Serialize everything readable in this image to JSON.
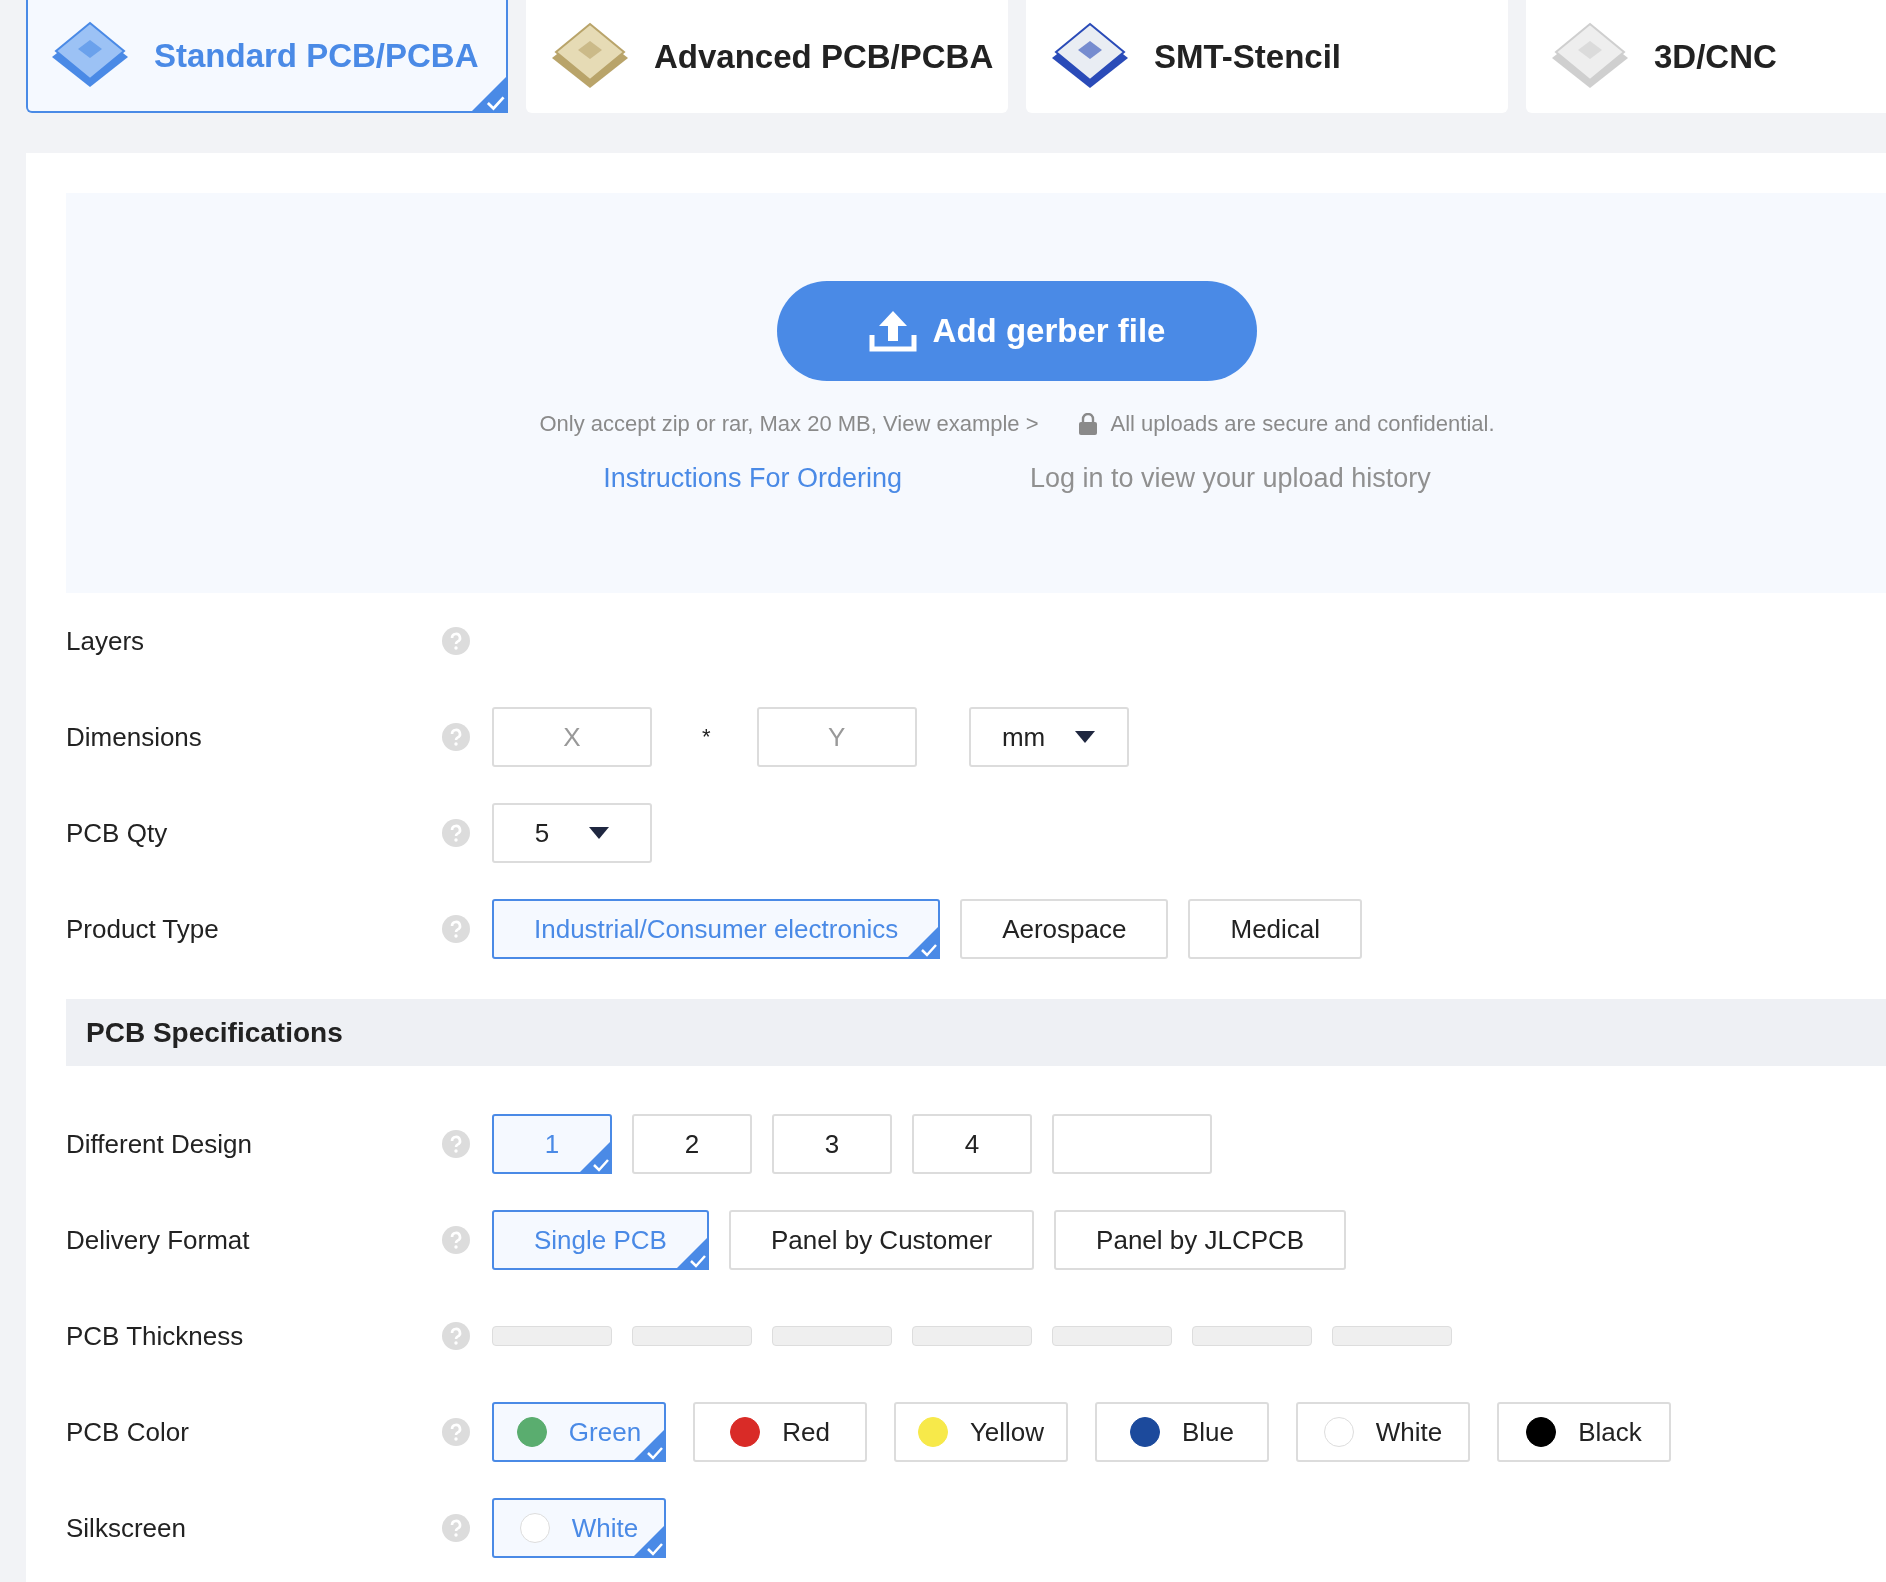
{
  "tabs": [
    {
      "label": "Standard PCB/PCBA",
      "selected": true,
      "kind": "standard"
    },
    {
      "label": "Advanced PCB/PCBA",
      "selected": false,
      "kind": "advanced"
    },
    {
      "label": "SMT-Stencil",
      "selected": false,
      "kind": "stencil"
    },
    {
      "label": "3D/CNC",
      "selected": false,
      "kind": "cnc"
    }
  ],
  "upload": {
    "button": "Add gerber file",
    "hint": "Only accept zip or rar, Max 20 MB, View example >",
    "secure_note": "All uploads are secure and confidential.",
    "instructions_link": "Instructions For Ordering",
    "history_link": "Log in to view your upload history"
  },
  "form_rows": [
    {
      "kind": "empty",
      "label": "Layers"
    },
    {
      "kind": "dimensions",
      "label": "Dimensions",
      "x_placeholder": "X",
      "separator": "*",
      "y_placeholder": "Y",
      "unit": "mm"
    },
    {
      "kind": "select",
      "label": "PCB Qty",
      "value": "5"
    },
    {
      "kind": "options",
      "label": "Product Type",
      "options": [
        {
          "kind": "option",
          "label": "Industrial/Consumer electronics",
          "selected": true
        },
        {
          "kind": "option",
          "label": "Aerospace",
          "selected": false
        },
        {
          "kind": "option",
          "label": "Medical",
          "selected": false
        }
      ]
    }
  ],
  "section_title": "PCB Specifications",
  "spec_rows": [
    {
      "kind": "options",
      "label": "Different Design",
      "options": [
        {
          "kind": "option",
          "label": "1",
          "selected": true
        },
        {
          "kind": "option",
          "label": "2",
          "selected": false
        },
        {
          "kind": "option",
          "label": "3",
          "selected": false
        },
        {
          "kind": "option",
          "label": "4",
          "selected": false
        },
        {
          "kind": "input"
        }
      ]
    },
    {
      "kind": "options",
      "label": "Delivery Format",
      "options": [
        {
          "kind": "option",
          "label": "Single PCB",
          "selected": true
        },
        {
          "kind": "option",
          "label": "Panel by Customer",
          "selected": false
        },
        {
          "kind": "option",
          "label": "Panel by JLCPCB",
          "selected": false
        }
      ]
    },
    {
      "kind": "loading",
      "label": "PCB Thickness",
      "options": [
        {
          "kind": "skeleton"
        },
        {
          "kind": "skeleton"
        },
        {
          "kind": "skeleton"
        },
        {
          "kind": "skeleton"
        },
        {
          "kind": "skeleton"
        },
        {
          "kind": "skeleton"
        },
        {
          "kind": "skeleton"
        }
      ]
    },
    {
      "kind": "colors",
      "label": "PCB Color",
      "options": [
        {
          "label": "Green",
          "color": "#5aad6f",
          "selected": true
        },
        {
          "label": "Red",
          "color": "#d92b27",
          "selected": false
        },
        {
          "label": "Yellow",
          "color": "#f7e94a",
          "selected": false
        },
        {
          "label": "Blue",
          "color": "#1c4a9c",
          "selected": false
        },
        {
          "label": "White",
          "color": "#ffffff",
          "selected": false
        },
        {
          "label": "Black",
          "color": "#000000",
          "selected": false
        }
      ]
    },
    {
      "kind": "colors",
      "label": "Silkscreen",
      "options": [
        {
          "label": "White",
          "color": "#ffffff",
          "selected": true
        }
      ]
    }
  ]
}
